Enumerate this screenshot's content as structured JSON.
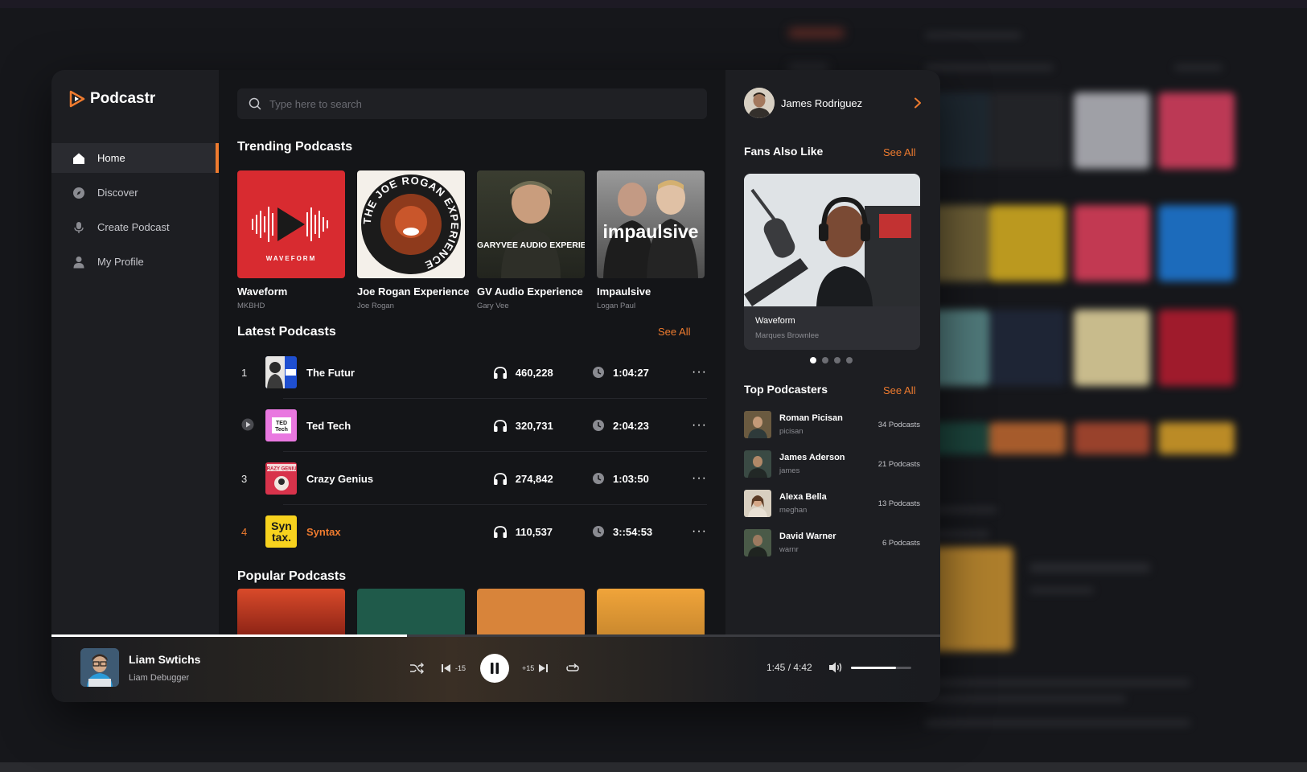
{
  "app": {
    "name": "Podcastr"
  },
  "colors": {
    "accent": "#ee7b2f",
    "background": "#141518",
    "panel": "#1d1e22"
  },
  "nav": [
    {
      "label": "Home",
      "icon": "home-icon",
      "active": true
    },
    {
      "label": "Discover",
      "icon": "compass-icon",
      "active": false
    },
    {
      "label": "Create Podcast",
      "icon": "microphone-icon",
      "active": false
    },
    {
      "label": "My Profile",
      "icon": "user-icon",
      "active": false
    }
  ],
  "search": {
    "placeholder": "Type here to search"
  },
  "trending": {
    "title": "Trending Podcasts",
    "items": [
      {
        "title": "Waveform",
        "author": "MKBHD",
        "cover_text": "WAVEFORM"
      },
      {
        "title": "Joe Rogan Experience",
        "author": "Joe Rogan",
        "cover_text": "THE JOE ROGAN EXPERIENCE"
      },
      {
        "title": "GV Audio Experience",
        "author": "Gary Vee",
        "cover_text": "THE GARYVEE AUDIO EXPERIENCE"
      },
      {
        "title": "Impaulsive",
        "author": "Logan Paul",
        "cover_text": "impaulsive"
      }
    ]
  },
  "latest": {
    "title": "Latest Podcasts",
    "see_all": "See All",
    "items": [
      {
        "rank": "1",
        "title": "The Futur",
        "listens": "460,228",
        "duration": "1:04:27",
        "state": "normal"
      },
      {
        "rank": "",
        "title": "Ted Tech",
        "listens": "320,731",
        "duration": "2:04:23",
        "state": "playing"
      },
      {
        "rank": "3",
        "title": "Crazy Genius",
        "listens": "274,842",
        "duration": "1:03:50",
        "state": "normal"
      },
      {
        "rank": "4",
        "title": "Syntax",
        "listens": "110,537",
        "duration": "3::54:53",
        "state": "highlight"
      }
    ],
    "more_label": "···"
  },
  "popular": {
    "title": "Popular Podcasts"
  },
  "user": {
    "name": "James Rodriguez"
  },
  "fans_also_like": {
    "title": "Fans Also Like",
    "see_all": "See All",
    "featured": {
      "title": "Waveform",
      "subtitle": "Marques Brownlee"
    },
    "slide_count": 4,
    "active_slide": 0
  },
  "top_podcasters": {
    "title": "Top Podcasters",
    "see_all": "See All",
    "items": [
      {
        "name": "Roman Picisan",
        "handle": "picisan",
        "count": "34 Podcasts"
      },
      {
        "name": "James Aderson",
        "handle": "james",
        "count": "21 Podcasts"
      },
      {
        "name": "Alexa Bella",
        "handle": "meghan",
        "count": "13 Podcasts"
      },
      {
        "name": "David Warner",
        "handle": "warnr",
        "count": "6 Podcasts"
      }
    ]
  },
  "player": {
    "title": "Liam Swtichs",
    "subtitle": "Liam Debugger",
    "time": "1:45 / 4:42",
    "progress": 0.4,
    "volume": 0.75,
    "rewind_label": "-15",
    "forward_label": "+15"
  }
}
